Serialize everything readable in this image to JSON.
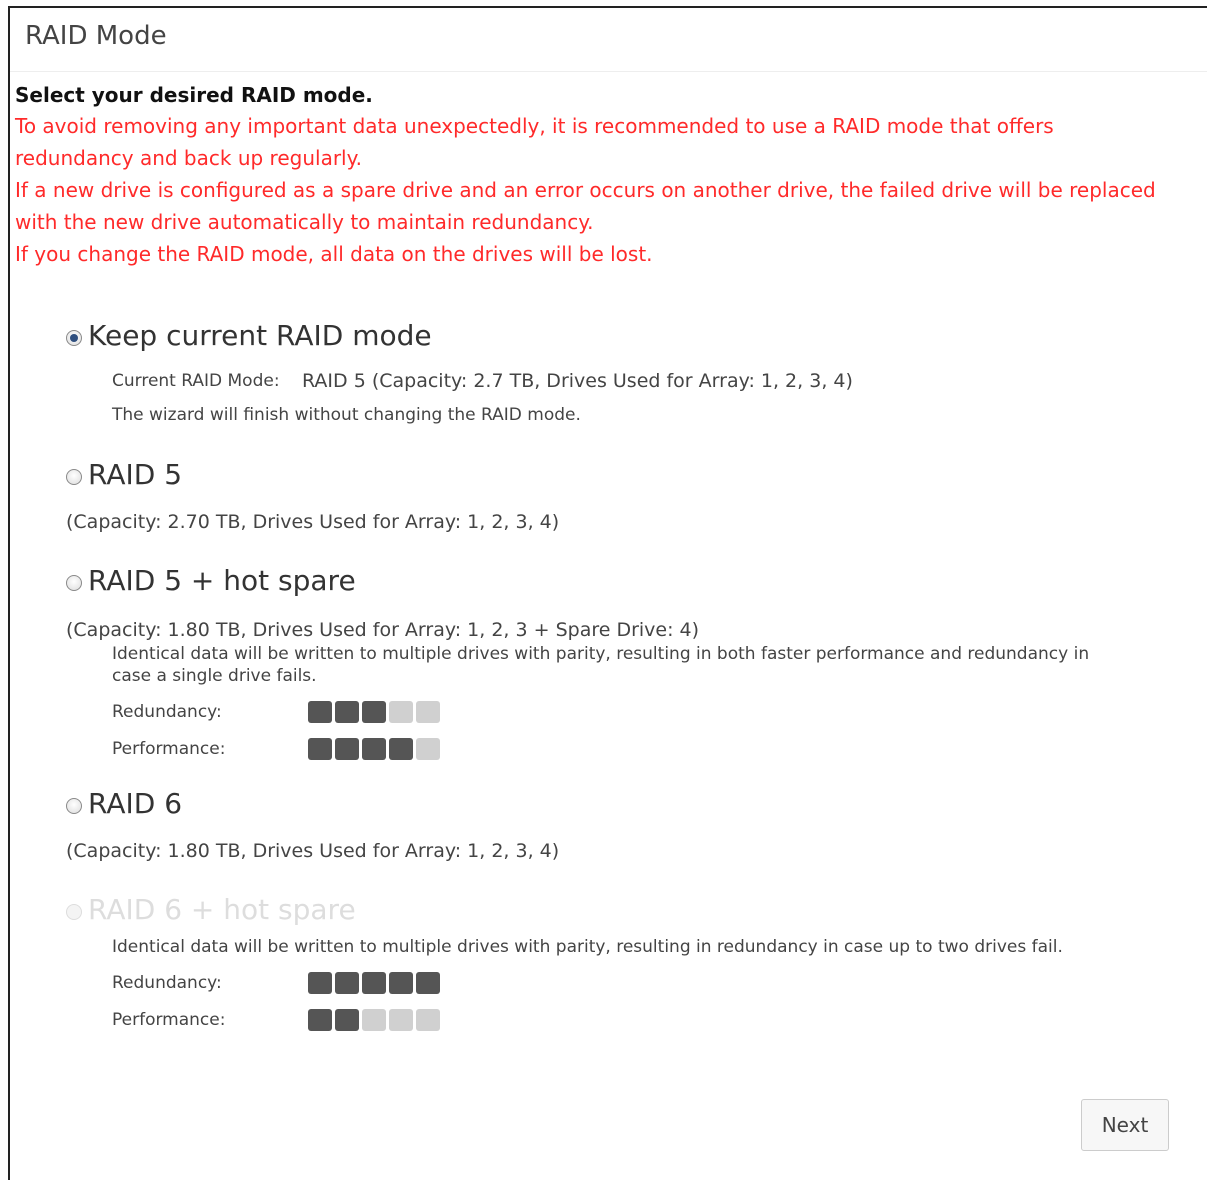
{
  "dialog": {
    "title": "RAID Mode"
  },
  "intro": {
    "heading": "Select your desired RAID mode.",
    "warnings": [
      "To avoid removing any important data unexpectedly, it is recommended to use a RAID mode that offers redundancy and back up regularly.",
      "If a new drive is configured as a spare drive and an error occurs on another drive, the failed drive will be replaced with the new drive automatically to maintain redundancy.",
      "If you change the RAID mode, all data on the drives will be lost."
    ]
  },
  "options": {
    "keep": {
      "label": "Keep current RAID mode",
      "selected": true,
      "current_key": "Current RAID Mode:",
      "current_value": "RAID 5 (Capacity: 2.7 TB, Drives Used for Array: 1, 2, 3, 4)",
      "note": "The wizard will finish without changing the RAID mode."
    },
    "raid5": {
      "label": "RAID 5",
      "capacity": "(Capacity: 2.70 TB, Drives Used for Array: 1, 2, 3, 4)"
    },
    "raid5_spare": {
      "label": "RAID 5 + hot spare",
      "capacity": "(Capacity: 1.80 TB, Drives Used for Array: 1, 2, 3 + Spare Drive: 4)",
      "description": "Identical data will be written to multiple drives with parity, resulting in both faster performance and redundancy in case a single drive fails.",
      "redundancy_label": "Redundancy:",
      "performance_label": "Performance:",
      "redundancy": 3,
      "performance": 4
    },
    "raid6": {
      "label": "RAID 6",
      "capacity": "(Capacity: 1.80 TB, Drives Used for Array: 1, 2, 3, 4)"
    },
    "raid6_spare": {
      "label": "RAID 6 + hot spare",
      "disabled": true,
      "description": "Identical data will be written to multiple drives with parity, resulting in redundancy in case up to two drives fail.",
      "redundancy_label": "Redundancy:",
      "performance_label": "Performance:",
      "redundancy": 5,
      "performance": 2
    }
  },
  "meter_max": 5,
  "colors": {
    "warning": "#ff2a2a",
    "meter_on": "#555555",
    "meter_off": "#d0d0d0"
  },
  "footer": {
    "next_label": "Next"
  }
}
